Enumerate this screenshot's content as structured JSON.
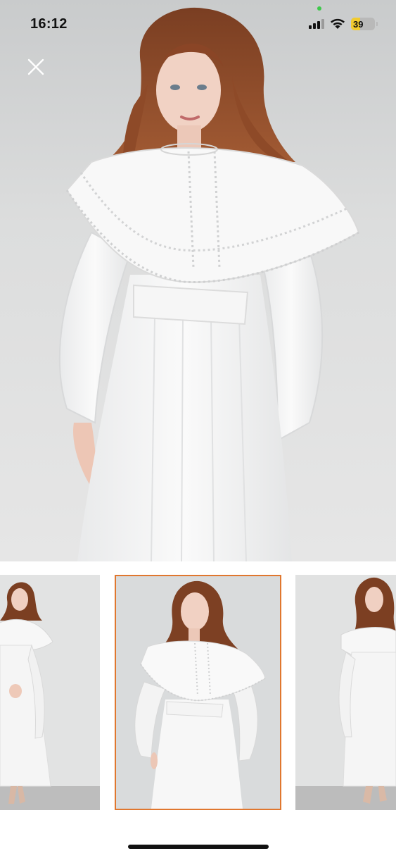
{
  "status_bar": {
    "time": "16:12",
    "battery_level": "39",
    "battery_fraction": 0.39,
    "icons": [
      "signal-icon",
      "wifi-icon",
      "battery-icon"
    ]
  },
  "viewer": {
    "close_icon": "close-icon",
    "selected_thumbnail_index": 1,
    "thumbnail_count": 3
  },
  "colors": {
    "selected_border": "#e0772f",
    "battery_fill": "#f2cb2f",
    "background": "#ffffff"
  }
}
